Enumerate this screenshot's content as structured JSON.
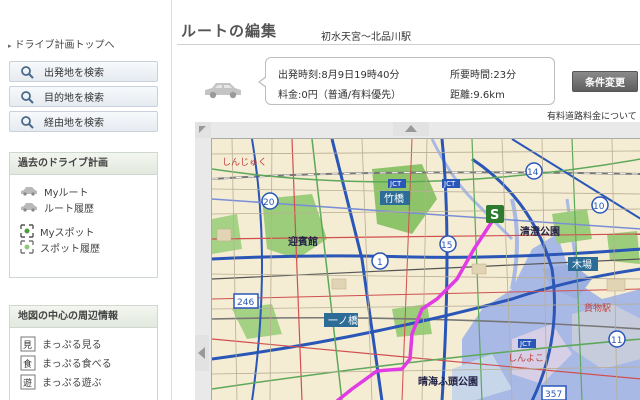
{
  "sidebar": {
    "top_link": "ドライブ計画トップへ",
    "search_buttons": [
      {
        "label": "出発地を検索",
        "icon": "search-icon"
      },
      {
        "label": "目的地を検索",
        "icon": "search-icon"
      },
      {
        "label": "経由地を検索",
        "icon": "search-icon"
      }
    ],
    "past_plans": {
      "title": "過去のドライブ計画",
      "items": [
        {
          "label": "Myルート",
          "icon": "car-icon"
        },
        {
          "label": "ルート履歴",
          "icon": "car-icon"
        },
        {
          "label": "Myスポット",
          "icon": "spot-icon"
        },
        {
          "label": "スポット履歴",
          "icon": "spot-icon"
        }
      ]
    },
    "nearby": {
      "title": "地図の中心の周辺情報",
      "items": [
        {
          "label": "まっぷる見る",
          "icon": "guide-see-icon"
        },
        {
          "label": "まっぷる食べる",
          "icon": "guide-eat-icon"
        },
        {
          "label": "まっぷる遊ぶ",
          "icon": "guide-play-icon"
        }
      ]
    }
  },
  "main": {
    "title": "ルートの編集",
    "route_name": "初水天宮〜北品川駅",
    "info": {
      "departure": "出発時刻:8月9日19時40分",
      "duration": "所要時間:23分",
      "fare": "料金:0円（普通/有料優先）",
      "distance": "距離:9.6km"
    },
    "condition_button": "条件変更",
    "toll_link": "有料道路料金について"
  },
  "map": {
    "labels": {
      "takebashi": "竹橋",
      "geihinkan": "迎賓館",
      "kiyosumi": "清澄公園",
      "kiba": "木場",
      "ichinohashi": "一ノ橋",
      "harumi": "晴海ふ頭公園",
      "shinjuku": "しんじゅく",
      "kamotsueki": "貨物駅",
      "jct": "JCT",
      "shinjo": "しんよこ"
    },
    "route_numbers": [
      "14",
      "20",
      "15",
      "1",
      "246",
      "10",
      "11",
      "357"
    ],
    "start_marker": "S"
  }
}
